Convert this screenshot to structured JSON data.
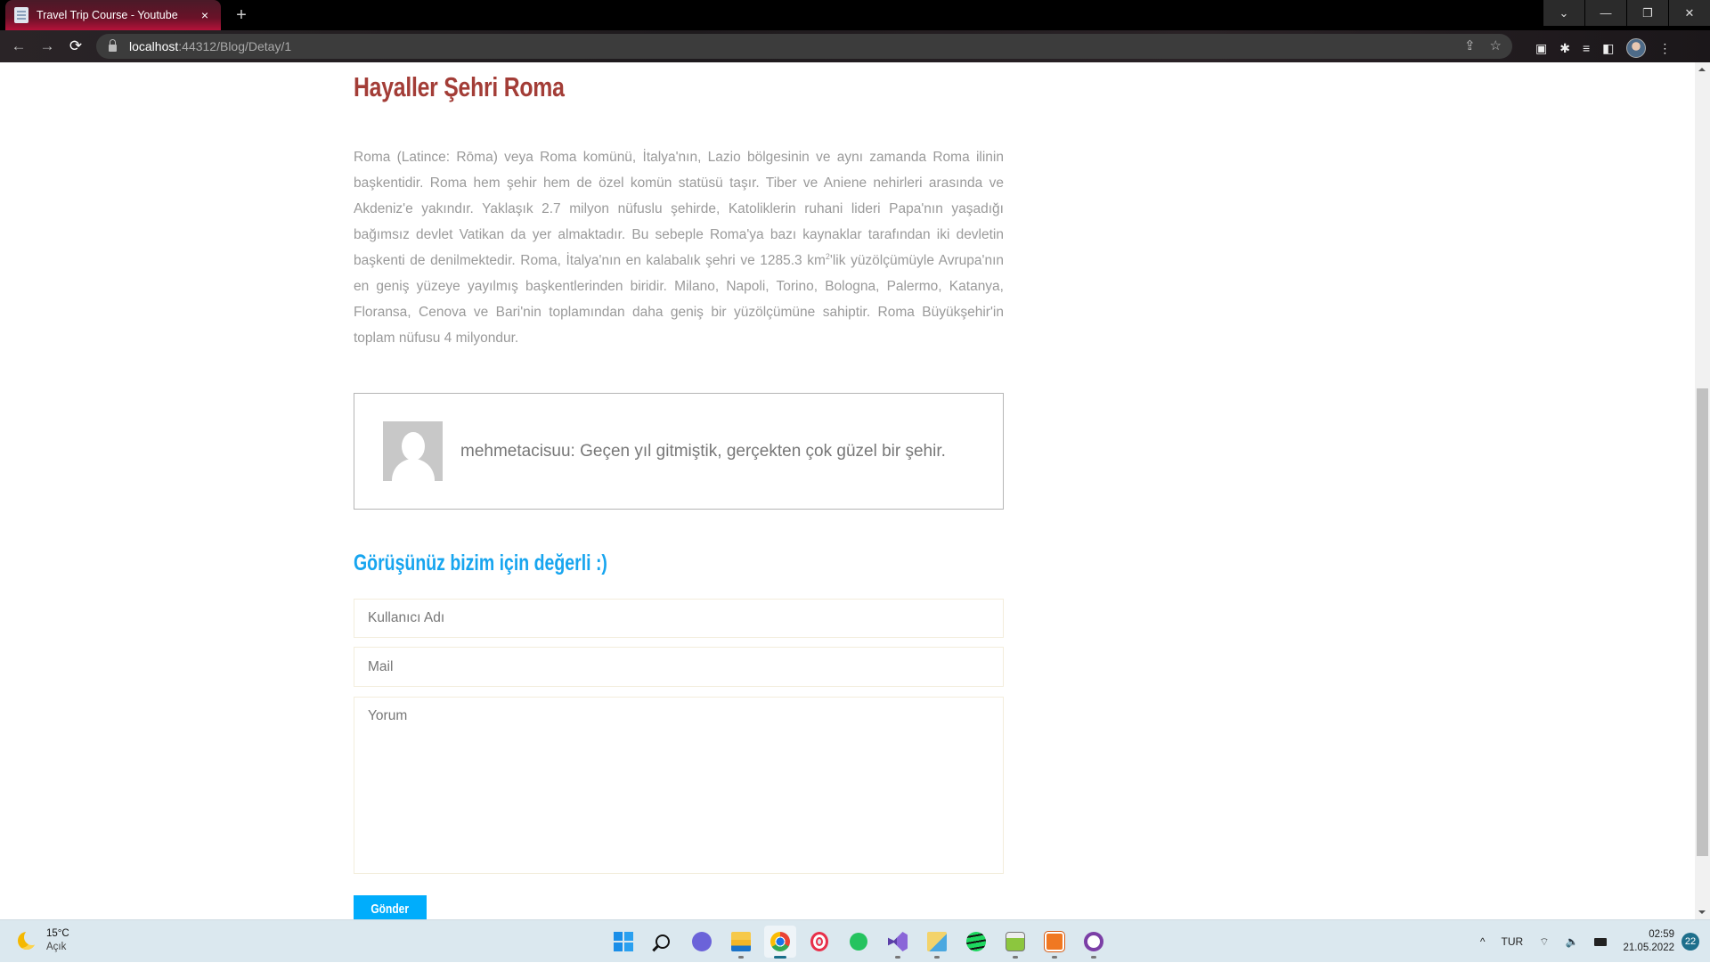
{
  "browser": {
    "tab_title": "Travel Trip Course - Youtube",
    "tab_close": "×",
    "new_tab": "+",
    "url_host": "localhost",
    "url_path": ":44312/Blog/Detay/1",
    "window_controls": {
      "tab_search": "⌄",
      "minimize": "—",
      "restore": "❐",
      "close": "✕"
    },
    "nav": {
      "back": "←",
      "forward": "→",
      "reload": "⟳"
    },
    "omnibox_icons": {
      "share": "⇪",
      "bookmark": "☆"
    },
    "extension_icons": {
      "media": "▣",
      "extensions": "✱",
      "reading_list": "≡",
      "side_panel": "◧",
      "menu": "⋮"
    }
  },
  "post": {
    "title": "Hayaller Şehri Roma",
    "body_part1": "Roma (Latince: Rōma) veya Roma komünü, İtalya'nın, Lazio bölgesinin ve aynı zamanda Roma ilinin başkentidir. Roma hem şehir hem de özel komün statüsü taşır. Tiber ve Aniene nehirleri arasında ve Akdeniz'e yakındır. Yaklaşık 2.7 milyon nüfuslu şehirde, Katoliklerin ruhani lideri Papa'nın yaşadığı bağımsız devlet Vatikan da yer almaktadır. Bu sebeple Roma'ya bazı kaynaklar tarafından iki devletin başkenti de denilmektedir. Roma, İtalya'nın en kalabalık şehri ve 1285.3 km",
    "body_sup": "2",
    "body_part2": "'lik yüzölçümüyle Avrupa'nın en geniş yüzeye yayılmış başkentlerinden biridir. Milano, Napoli, Torino, Bologna, Palermo, Katanya, Floransa, Cenova ve Bari'nin toplamından daha geniş bir yüzölçümüne sahiptir. Roma Büyükşehir'in toplam nüfusu 4 milyondur."
  },
  "comments": [
    {
      "text": "mehmetacisuu: Geçen yıl gitmiştik, gerçekten çok güzel bir şehir."
    }
  ],
  "form": {
    "heading": "Görüşünüz bizim için değerli :)",
    "username_placeholder": "Kullanıcı Adı",
    "mail_placeholder": "Mail",
    "comment_placeholder": "Yorum",
    "submit_label": "Gönder"
  },
  "taskbar": {
    "weather_temp": "15°C",
    "weather_desc": "Açık",
    "apps": [
      "start",
      "search",
      "teams-chat",
      "file-explorer",
      "chrome",
      "opera",
      "whatsapp",
      "visual-studio",
      "sql-tool",
      "spotify",
      "notepad-plus",
      "xampp",
      "github-desktop"
    ],
    "tray_chevron": "^",
    "language": "TUR",
    "time": "02:59",
    "date": "21.05.2022",
    "notifications": "22"
  }
}
